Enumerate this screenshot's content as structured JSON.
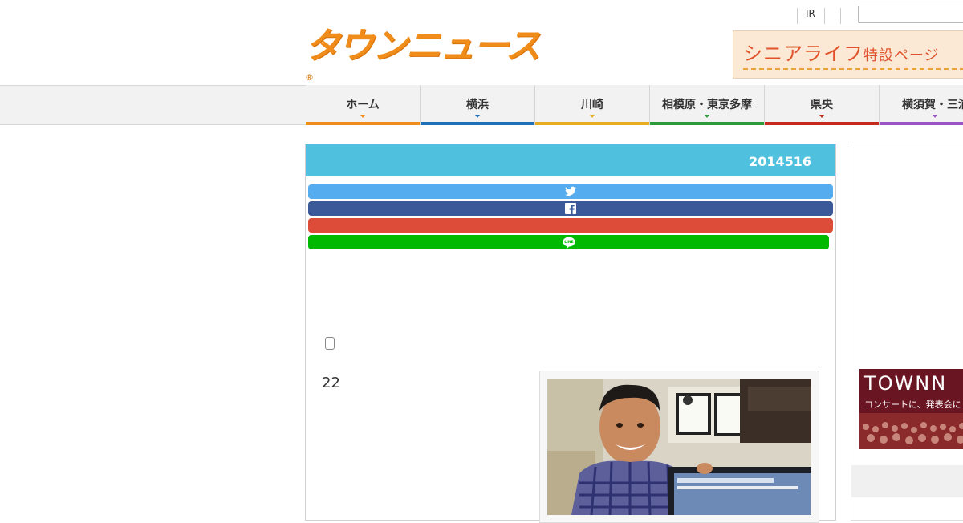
{
  "header": {
    "logo_text": "タウンニュース",
    "logo_mark": "®",
    "util_links": [
      "IR"
    ],
    "search_placeholder": "",
    "banner": {
      "text_big": "シニアライフ",
      "text_small": "特設ページ"
    }
  },
  "nav": {
    "items": [
      {
        "label": "ホーム",
        "color": "#f08c1a"
      },
      {
        "label": "横浜",
        "color": "#1f6fb8"
      },
      {
        "label": "川崎",
        "color": "#e8ac22"
      },
      {
        "label": "相模原・東京多摩",
        "color": "#2e9a3e"
      },
      {
        "label": "県央",
        "color": "#c7281e"
      },
      {
        "label": "横須賀・三浦",
        "color": "#9a55c4"
      }
    ]
  },
  "article": {
    "date": "2014516",
    "number": "22",
    "share_buttons": [
      {
        "name": "twitter",
        "color": "#55acee",
        "icon": "twitter-bird-icon"
      },
      {
        "name": "facebook",
        "color": "#3b5998",
        "icon": "facebook-f-icon"
      },
      {
        "name": "google-plus",
        "color": "#dd4b39",
        "icon": ""
      },
      {
        "name": "line",
        "color": "#00b900",
        "icon": "line-icon"
      }
    ]
  },
  "sidebar": {
    "ad_title": "TOWNN",
    "ad_sub": "コンサートに、発表会に"
  }
}
